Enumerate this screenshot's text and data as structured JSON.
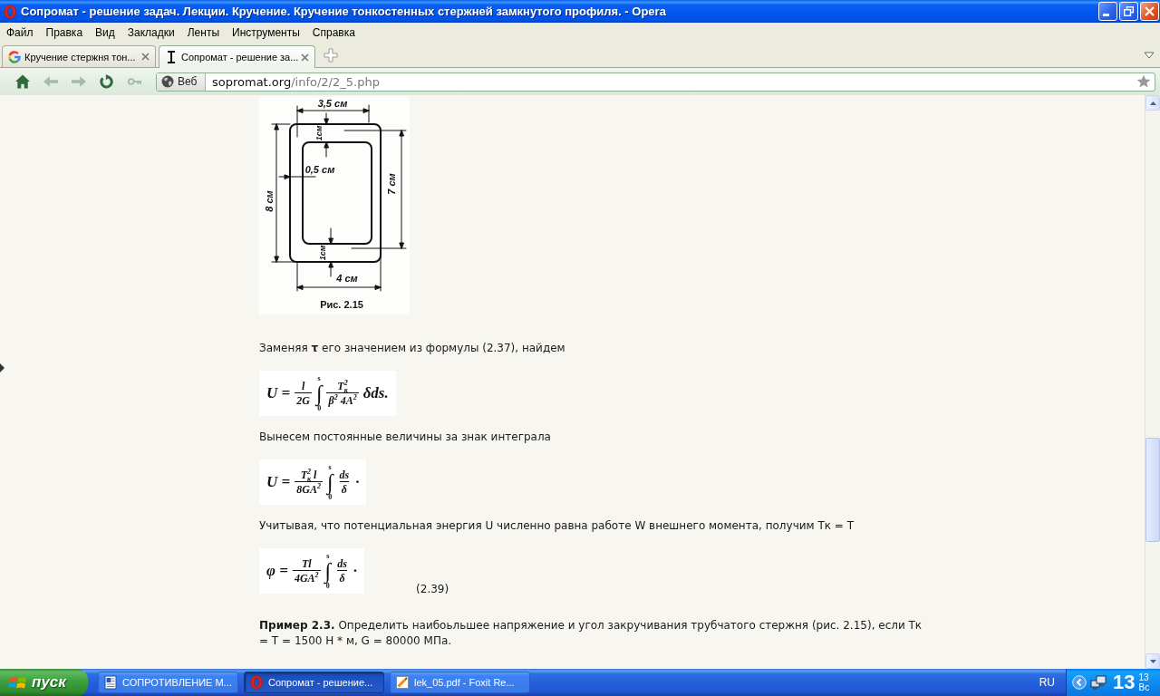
{
  "window": {
    "title": "Сопромат - решение задач. Лекции. Кручение. Кручение тонкостенных стержней замкнутого профиля. - Opera"
  },
  "menu": [
    "Файл",
    "Правка",
    "Вид",
    "Закладки",
    "Ленты",
    "Инструменты",
    "Справка"
  ],
  "tabs": [
    {
      "kind": "g-logo",
      "label": "Кручение стержня тон...",
      "selected": false
    },
    {
      "kind": "text-cursor",
      "label": "Сопромат - решение за...",
      "selected": true
    }
  ],
  "nav": [
    {
      "kind": "home",
      "disabled": false
    },
    {
      "kind": "back",
      "disabled": true
    },
    {
      "kind": "forward",
      "disabled": true
    },
    {
      "kind": "reload",
      "disabled": false
    },
    {
      "kind": "key",
      "disabled": true
    }
  ],
  "address": {
    "scope": "Веб",
    "host": "sopromat.org",
    "path": "/info/2/2_5.php"
  },
  "page": {
    "figure": {
      "labels": [
        "3,5 см",
        "1см",
        "0,5 см",
        "8 см",
        "7 см",
        "1см",
        "4 см"
      ],
      "caption": "Рис. 2.15"
    },
    "blocks": [
      {
        "kind": "paragraph",
        "text": "Заменяя **τ** его значением из формулы (2.37), найдем"
      },
      {
        "kind": "formula",
        "parts": [
          {
            "kind": "text",
            "text": "U ="
          },
          {
            "kind": "frac",
            "num": "l",
            "den": "2G"
          },
          {
            "kind": "int",
            "sign": "∫",
            "upper": "s",
            "lower": "0"
          },
          {
            "kind": "frac",
            "num": "T$^{2}$$_{к}$",
            "den": "β$^{2}$ 4A$^{2}$"
          },
          {
            "kind": "text",
            "text": "δds."
          }
        ]
      },
      {
        "kind": "paragraph",
        "text": "Вынесем постоянные величины за знак интеграла"
      },
      {
        "kind": "formula",
        "parts": [
          {
            "kind": "text",
            "text": "U ="
          },
          {
            "kind": "frac",
            "num": "T$^{2}$$_{к}$ l",
            "den": "8GA$^{2}$"
          },
          {
            "kind": "int",
            "sign": "∫",
            "upper": "s",
            "lower": "0"
          },
          {
            "kind": "frac",
            "num": "ds",
            "den": "δ"
          },
          {
            "kind": "text",
            "text": "·"
          }
        ]
      },
      {
        "kind": "paragraph",
        "text": "Учитывая, что потенциальная энергия U численно равна работе W внешнего момента, получим Тк = Т"
      },
      {
        "kind": "formula",
        "parts": [
          {
            "kind": "text",
            "text": "φ ="
          },
          {
            "kind": "frac",
            "num": "Tl",
            "den": "4GA$^{2}$"
          },
          {
            "kind": "int",
            "sign": "∫",
            "upper": "s",
            "lower": "0"
          },
          {
            "kind": "frac",
            "num": "ds",
            "den": "δ"
          },
          {
            "kind": "text",
            "text": "·"
          }
        ],
        "number": "(2.39)"
      },
      {
        "kind": "paragraph",
        "text": "**Пример 2.3.** Определить наибоьльшее напряжение и угол закручивания трубчатого стержня (рис. 2.15), если Тк = Т = 1500 Н * м, G = 80000 МПа."
      }
    ]
  },
  "taskbar": {
    "start": "пуск",
    "tasks": [
      {
        "kind": "document",
        "label": "СОПРОТИВЛЕНИЕ М...",
        "selected": false
      },
      {
        "kind": "browser",
        "label": "Сопромат - решение...",
        "selected": true
      },
      {
        "kind": "pdf",
        "label": "lek_05.pdf - Foxit Re...",
        "selected": false
      }
    ],
    "language": "RU",
    "clock": {
      "hours": "13",
      "minutes": "13",
      "day": "Вс"
    }
  }
}
